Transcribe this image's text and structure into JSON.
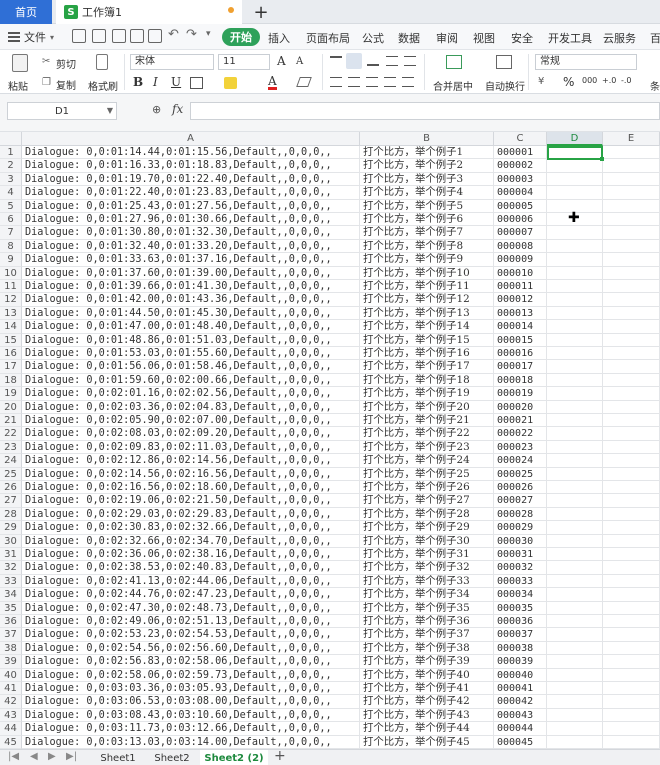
{
  "tabs": {
    "home_label": "首页",
    "doc_icon_letter": "S",
    "doc_title": "工作簿1",
    "add_label": "+"
  },
  "menu": {
    "file_label": "文件",
    "start_label": "开始",
    "items": [
      "插入",
      "页面布局",
      "公式",
      "数据",
      "审阅",
      "视图",
      "安全",
      "开发工具",
      "云服务",
      "百"
    ]
  },
  "ribbon": {
    "cut_label": "剪切",
    "paste_label": "粘贴",
    "copy_label": "复制",
    "format_painter_label": "格式刷",
    "font_name": "宋体",
    "font_size": "11",
    "merge_label": "合并居中",
    "wrap_label": "自动换行",
    "number_format": "常规",
    "cond_label": "条",
    "bold": "B",
    "italic": "I",
    "underline": "U",
    "grow_font": "A",
    "font_color_letter": "A",
    "percent": "%",
    "thousands": "000",
    "dec_inc": "+.0",
    "dec_dec": "-.0"
  },
  "formula": {
    "name_box": "D1",
    "fx_label": "fx",
    "content": ""
  },
  "columns": [
    "A",
    "B",
    "C",
    "D",
    "E"
  ],
  "selected_column": "D",
  "rows": [
    {
      "n": "1",
      "a": "Dialogue: 0,0:01:14.44,0:01:15.56,Default,,0,0,0,,",
      "b": "打个比方，举个例子1",
      "c": "000001"
    },
    {
      "n": "2",
      "a": "Dialogue: 0,0:01:16.33,0:01:18.83,Default,,0,0,0,,",
      "b": "打个比方，举个例子2",
      "c": "000002"
    },
    {
      "n": "3",
      "a": "Dialogue: 0,0:01:19.70,0:01:22.40,Default,,0,0,0,,",
      "b": "打个比方，举个例子3",
      "c": "000003"
    },
    {
      "n": "4",
      "a": "Dialogue: 0,0:01:22.40,0:01:23.83,Default,,0,0,0,,",
      "b": "打个比方，举个例子4",
      "c": "000004"
    },
    {
      "n": "5",
      "a": "Dialogue: 0,0:01:25.43,0:01:27.56,Default,,0,0,0,,",
      "b": "打个比方，举个例子5",
      "c": "000005"
    },
    {
      "n": "6",
      "a": "Dialogue: 0,0:01:27.96,0:01:30.66,Default,,0,0,0,,",
      "b": "打个比方，举个例子6",
      "c": "000006"
    },
    {
      "n": "7",
      "a": "Dialogue: 0,0:01:30.80,0:01:32.30,Default,,0,0,0,,",
      "b": "打个比方，举个例子7",
      "c": "000007"
    },
    {
      "n": "8",
      "a": "Dialogue: 0,0:01:32.40,0:01:33.20,Default,,0,0,0,,",
      "b": "打个比方，举个例子8",
      "c": "000008"
    },
    {
      "n": "9",
      "a": "Dialogue: 0,0:01:33.63,0:01:37.16,Default,,0,0,0,,",
      "b": "打个比方，举个例子9",
      "c": "000009"
    },
    {
      "n": "10",
      "a": "Dialogue: 0,0:01:37.60,0:01:39.00,Default,,0,0,0,,",
      "b": "打个比方，举个例子10",
      "c": "000010"
    },
    {
      "n": "11",
      "a": "Dialogue: 0,0:01:39.66,0:01:41.30,Default,,0,0,0,,",
      "b": "打个比方，举个例子11",
      "c": "000011"
    },
    {
      "n": "12",
      "a": "Dialogue: 0,0:01:42.00,0:01:43.36,Default,,0,0,0,,",
      "b": "打个比方，举个例子12",
      "c": "000012"
    },
    {
      "n": "13",
      "a": "Dialogue: 0,0:01:44.50,0:01:45.30,Default,,0,0,0,,",
      "b": "打个比方，举个例子13",
      "c": "000013"
    },
    {
      "n": "14",
      "a": "Dialogue: 0,0:01:47.00,0:01:48.40,Default,,0,0,0,,",
      "b": "打个比方，举个例子14",
      "c": "000014"
    },
    {
      "n": "15",
      "a": "Dialogue: 0,0:01:48.86,0:01:51.03,Default,,0,0,0,,",
      "b": "打个比方，举个例子15",
      "c": "000015"
    },
    {
      "n": "16",
      "a": "Dialogue: 0,0:01:53.03,0:01:55.60,Default,,0,0,0,,",
      "b": "打个比方，举个例子16",
      "c": "000016"
    },
    {
      "n": "17",
      "a": "Dialogue: 0,0:01:56.06,0:01:58.46,Default,,0,0,0,,",
      "b": "打个比方，举个例子17",
      "c": "000017"
    },
    {
      "n": "18",
      "a": "Dialogue: 0,0:01:59.60,0:02:00.66,Default,,0,0,0,,",
      "b": "打个比方，举个例子18",
      "c": "000018"
    },
    {
      "n": "19",
      "a": "Dialogue: 0,0:02:01.16,0:02:02.56,Default,,0,0,0,,",
      "b": "打个比方，举个例子19",
      "c": "000019"
    },
    {
      "n": "20",
      "a": "Dialogue: 0,0:02:03.36,0:02:04.83,Default,,0,0,0,,",
      "b": "打个比方，举个例子20",
      "c": "000020"
    },
    {
      "n": "21",
      "a": "Dialogue: 0,0:02:05.90,0:02:07.00,Default,,0,0,0,,",
      "b": "打个比方，举个例子21",
      "c": "000021"
    },
    {
      "n": "22",
      "a": "Dialogue: 0,0:02:08.03,0:02:09.20,Default,,0,0,0,,",
      "b": "打个比方，举个例子22",
      "c": "000022"
    },
    {
      "n": "23",
      "a": "Dialogue: 0,0:02:09.83,0:02:11.03,Default,,0,0,0,,",
      "b": "打个比方，举个例子23",
      "c": "000023"
    },
    {
      "n": "24",
      "a": "Dialogue: 0,0:02:12.86,0:02:14.56,Default,,0,0,0,,",
      "b": "打个比方，举个例子24",
      "c": "000024"
    },
    {
      "n": "25",
      "a": "Dialogue: 0,0:02:14.56,0:02:16.56,Default,,0,0,0,,",
      "b": "打个比方，举个例子25",
      "c": "000025"
    },
    {
      "n": "26",
      "a": "Dialogue: 0,0:02:16.56,0:02:18.60,Default,,0,0,0,,",
      "b": "打个比方，举个例子26",
      "c": "000026"
    },
    {
      "n": "27",
      "a": "Dialogue: 0,0:02:19.06,0:02:21.50,Default,,0,0,0,,",
      "b": "打个比方，举个例子27",
      "c": "000027"
    },
    {
      "n": "28",
      "a": "Dialogue: 0,0:02:29.03,0:02:29.83,Default,,0,0,0,,",
      "b": "打个比方，举个例子28",
      "c": "000028"
    },
    {
      "n": "29",
      "a": "Dialogue: 0,0:02:30.83,0:02:32.66,Default,,0,0,0,,",
      "b": "打个比方，举个例子29",
      "c": "000029"
    },
    {
      "n": "30",
      "a": "Dialogue: 0,0:02:32.66,0:02:34.70,Default,,0,0,0,,",
      "b": "打个比方，举个例子30",
      "c": "000030"
    },
    {
      "n": "31",
      "a": "Dialogue: 0,0:02:36.06,0:02:38.16,Default,,0,0,0,,",
      "b": "打个比方，举个例子31",
      "c": "000031"
    },
    {
      "n": "32",
      "a": "Dialogue: 0,0:02:38.53,0:02:40.83,Default,,0,0,0,,",
      "b": "打个比方，举个例子32",
      "c": "000032"
    },
    {
      "n": "33",
      "a": "Dialogue: 0,0:02:41.13,0:02:44.06,Default,,0,0,0,,",
      "b": "打个比方，举个例子33",
      "c": "000033"
    },
    {
      "n": "34",
      "a": "Dialogue: 0,0:02:44.76,0:02:47.23,Default,,0,0,0,,",
      "b": "打个比方，举个例子34",
      "c": "000034"
    },
    {
      "n": "35",
      "a": "Dialogue: 0,0:02:47.30,0:02:48.73,Default,,0,0,0,,",
      "b": "打个比方，举个例子35",
      "c": "000035"
    },
    {
      "n": "36",
      "a": "Dialogue: 0,0:02:49.06,0:02:51.13,Default,,0,0,0,,",
      "b": "打个比方，举个例子36",
      "c": "000036"
    },
    {
      "n": "37",
      "a": "Dialogue: 0,0:02:53.23,0:02:54.53,Default,,0,0,0,,",
      "b": "打个比方，举个例子37",
      "c": "000037"
    },
    {
      "n": "38",
      "a": "Dialogue: 0,0:02:54.56,0:02:56.60,Default,,0,0,0,,",
      "b": "打个比方，举个例子38",
      "c": "000038"
    },
    {
      "n": "39",
      "a": "Dialogue: 0,0:02:56.83,0:02:58.06,Default,,0,0,0,,",
      "b": "打个比方，举个例子39",
      "c": "000039"
    },
    {
      "n": "40",
      "a": "Dialogue: 0,0:02:58.06,0:02:59.73,Default,,0,0,0,,",
      "b": "打个比方，举个例子40",
      "c": "000040"
    },
    {
      "n": "41",
      "a": "Dialogue: 0,0:03:03.36,0:03:05.93,Default,,0,0,0,,",
      "b": "打个比方，举个例子41",
      "c": "000041"
    },
    {
      "n": "42",
      "a": "Dialogue: 0,0:03:06.53,0:03:08.00,Default,,0,0,0,,",
      "b": "打个比方，举个例子42",
      "c": "000042"
    },
    {
      "n": "43",
      "a": "Dialogue: 0,0:03:08.43,0:03:10.60,Default,,0,0,0,,",
      "b": "打个比方，举个例子43",
      "c": "000043"
    },
    {
      "n": "44",
      "a": "Dialogue: 0,0:03:11.73,0:03:12.66,Default,,0,0,0,,",
      "b": "打个比方，举个例子44",
      "c": "000044"
    },
    {
      "n": "45",
      "a": "Dialogue: 0,0:03:13.03,0:03:14.00,Default,,0,0,0,,",
      "b": "打个比方，举个例子45",
      "c": "000045"
    }
  ],
  "sheets": [
    {
      "label": "Sheet1",
      "active": false
    },
    {
      "label": "Sheet2",
      "active": false
    },
    {
      "label": "Sheet2 (2)",
      "active": true
    }
  ],
  "sheet_add_label": "+",
  "colors": {
    "accent_green": "#27a345",
    "home_tab_blue": "#2f6fd6",
    "start_button_green": "#2ea15a"
  }
}
